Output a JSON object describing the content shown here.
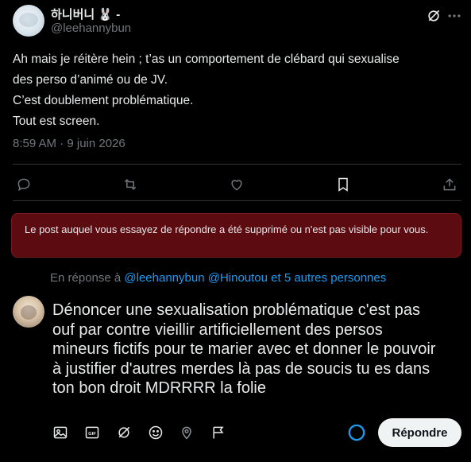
{
  "author": {
    "name": "하니버니 🐰 -",
    "handle": "@leehannybun"
  },
  "tweet": {
    "lines": [
      "Ah mais je réitère hein ; t’as un comportement de clébard qui sexualise",
      "des perso d’animé ou de JV.",
      "C’est doublement problématique.",
      "Tout est screen."
    ],
    "timestamp": "8:59 AM · 9 juin 2026"
  },
  "actions": [
    "reply-icon",
    "retweet-icon",
    "like-icon",
    "bookmark-icon",
    "share-icon"
  ],
  "notice": {
    "text": "Le post auquel vous essayez de répondre a été supprimé ou n'est pas visible pour vous."
  },
  "reply_context": {
    "prefix": "En réponse à",
    "mentions": "@leehannybun @Hinoutou et 5 autres personnes"
  },
  "compose": {
    "lines": [
      "Dénoncer une sexualisation problématique c'est pas",
      "ouf par contre vieillir artificiellement des persos",
      "mineurs fictifs pour te marier avec et donner le pouvoir",
      "à justifier d'autres merdes là pas de soucis tu es dans",
      "ton bon droit MDRRRR la folie"
    ]
  },
  "toolbar": {
    "icons": [
      "media-icon",
      "gif-icon",
      "grok-icon",
      "emoji-icon",
      "location-icon",
      "schedule-icon"
    ],
    "gif_label": "GIF",
    "reply_label": "Répondre"
  },
  "colors": {
    "accent": "#1d9bf0",
    "notice_bg": "#5c0b11",
    "muted": "#71767b",
    "text": "#e7e9ea"
  }
}
